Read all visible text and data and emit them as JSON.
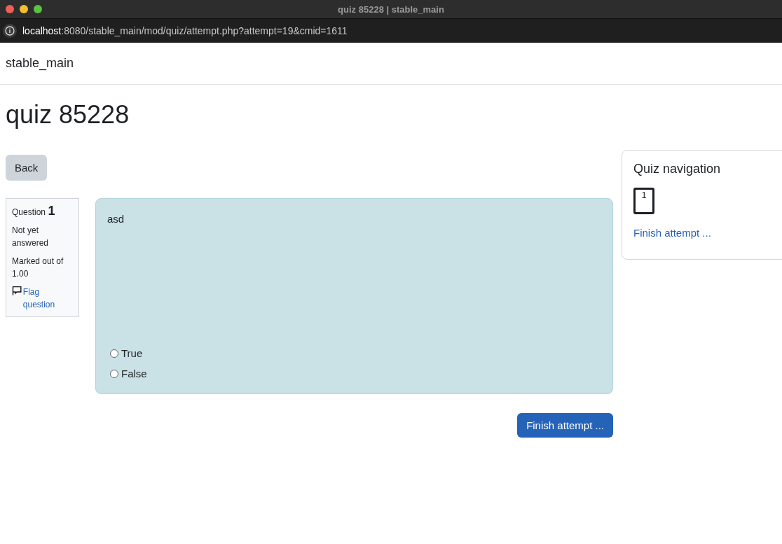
{
  "window": {
    "title": "quiz 85228 | stable_main"
  },
  "address_bar": {
    "url": "**localhost**:8080/stable_main/mod/quiz/attempt.php?attempt=19&cmid=1611"
  },
  "site_name": "stable_main",
  "page_title": "quiz 85228",
  "back_button": "Back",
  "question_info": {
    "label": "Question",
    "number": "1",
    "status": "Not yet answered",
    "marks": "Marked out of 1.00",
    "flag": {
      "label": "Flag question",
      "flagged": false
    }
  },
  "question": {
    "text": "asd",
    "options": [
      {
        "label": "True",
        "selected": false
      },
      {
        "label": "False",
        "selected": false
      }
    ]
  },
  "finish_button": "Finish attempt ...",
  "quiz_navigation": {
    "title": "Quiz navigation",
    "questions": [
      {
        "label": "1",
        "selected": true
      }
    ],
    "finish_link": "Finish attempt ..."
  }
}
